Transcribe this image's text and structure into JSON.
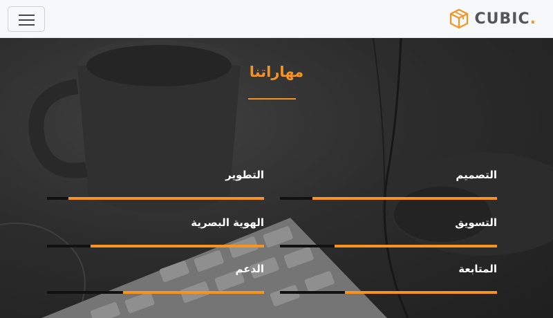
{
  "navbar": {
    "brand_text": "CUBIC",
    "brand_dot": ".",
    "menu_icon": "hamburger-menu-icon",
    "logo_icon": "cube-icon",
    "accent": "#f7931e"
  },
  "section": {
    "title": "مهاراتنا"
  },
  "skills": [
    {
      "label": "التصميم",
      "level": 0.85
    },
    {
      "label": "التطوير",
      "level": 0.9
    },
    {
      "label": "التسويق",
      "level": 0.75
    },
    {
      "label": "الهوية البصرية",
      "level": 0.8
    },
    {
      "label": "المتابعة",
      "level": 0.7
    },
    {
      "label": "الدعم",
      "level": 0.65
    }
  ]
}
